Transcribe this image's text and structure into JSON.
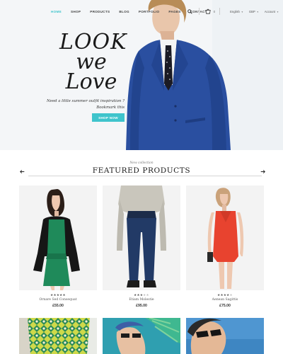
{
  "header": {
    "nav": [
      "HOME",
      "SHOP",
      "PRODUCTS",
      "BLOG",
      "PORTFOLIO",
      "PAGES",
      "CONTACT"
    ],
    "cart_count": "0",
    "language": "English",
    "currency": "GBP",
    "account": "Account"
  },
  "hero": {
    "title_lines": [
      "LOOK",
      "we",
      "Love"
    ],
    "subtitle_lines": [
      "Need a little summer outfit inspiration ?",
      "Bookmark this"
    ],
    "button": "SHOP NOW"
  },
  "featured": {
    "eyebrow": "New collection",
    "title": "FEATURED PRODUCTS",
    "products": [
      {
        "name": "Ornare Sed Consequat",
        "price": "£55.00",
        "rating": 5
      },
      {
        "name": "Etiam Molestie",
        "price": "£95.00",
        "rating": 3
      },
      {
        "name": "Aenean Sagittis",
        "price": "£75.00",
        "rating": 4
      }
    ]
  },
  "colors": {
    "accent": "#3fc4cc",
    "text": "#222222",
    "blazer": "#2a4fa0",
    "green_dress": "#1f8a5a",
    "red_dress": "#e8432f"
  },
  "icons": [
    "search-icon",
    "cart-icon",
    "arrow-left-icon",
    "arrow-right-icon",
    "star-icon"
  ]
}
